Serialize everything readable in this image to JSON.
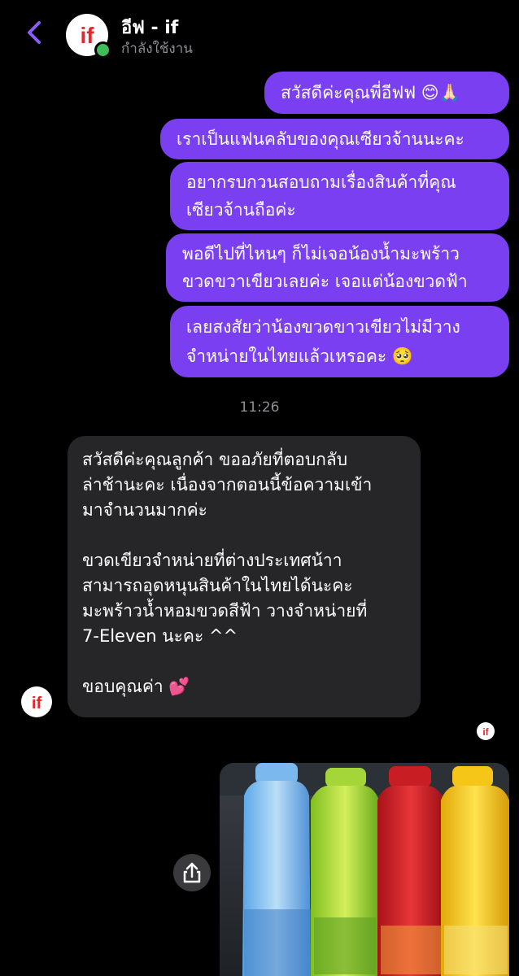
{
  "header": {
    "name": "อีฟ - if",
    "status": "กำลังใช้งาน"
  },
  "messages": {
    "outgoing": [
      "สวัสดีค่ะคุณพี่อีฟฟ 😊🙏🏻",
      "เราเป็นแฟนคลับของคุณเซียวจ้านนะคะ",
      [
        "อยากรบกวนสอบถามเรื่องสินค้าที่คุณ",
        "เซียวจ้านถือค่ะ"
      ],
      [
        "พอดีไปที่ไหนๆ ก็ไม่เจอน้องน้ำมะพร้าว",
        "ขวดขวาเขียวเลยค่ะ เจอแต่น้องขวดฟ้า"
      ],
      [
        "เลยสงสัยว่าน้องขวดขาวเขียวไม่มีวาง",
        "จำหน่ายในไทยแล้วเหรอคะ 🥺"
      ]
    ],
    "timestamp": "11:26",
    "incoming": {
      "lines": [
        "สวัสดีค่ะคุณลูกค้า ขออภัยที่ตอบกลับ",
        "ล่าช้านะคะ เนื่องจากตอนนี้ข้อความเข้า",
        "มาจำนวนมากค่ะ",
        "",
        "ขวดเขียวจำหน่ายที่ต่างประเทศน้าา",
        "สามารถอุดหนุนสินค้าในไทยได้นะคะ",
        "มะพร้าวน้ำหอมขวดสีฟ้า วางจำหน่ายที่",
        "7-Eleven นะคะ ^^",
        "",
        "ขอบคุณค่า 💕"
      ]
    }
  },
  "brand": {
    "logo_text": "if",
    "logo_color": "#e5262a"
  },
  "colors": {
    "outgoing_bubble": "#7a3ff0",
    "incoming_bubble": "#262628",
    "online": "#3fbd58"
  }
}
